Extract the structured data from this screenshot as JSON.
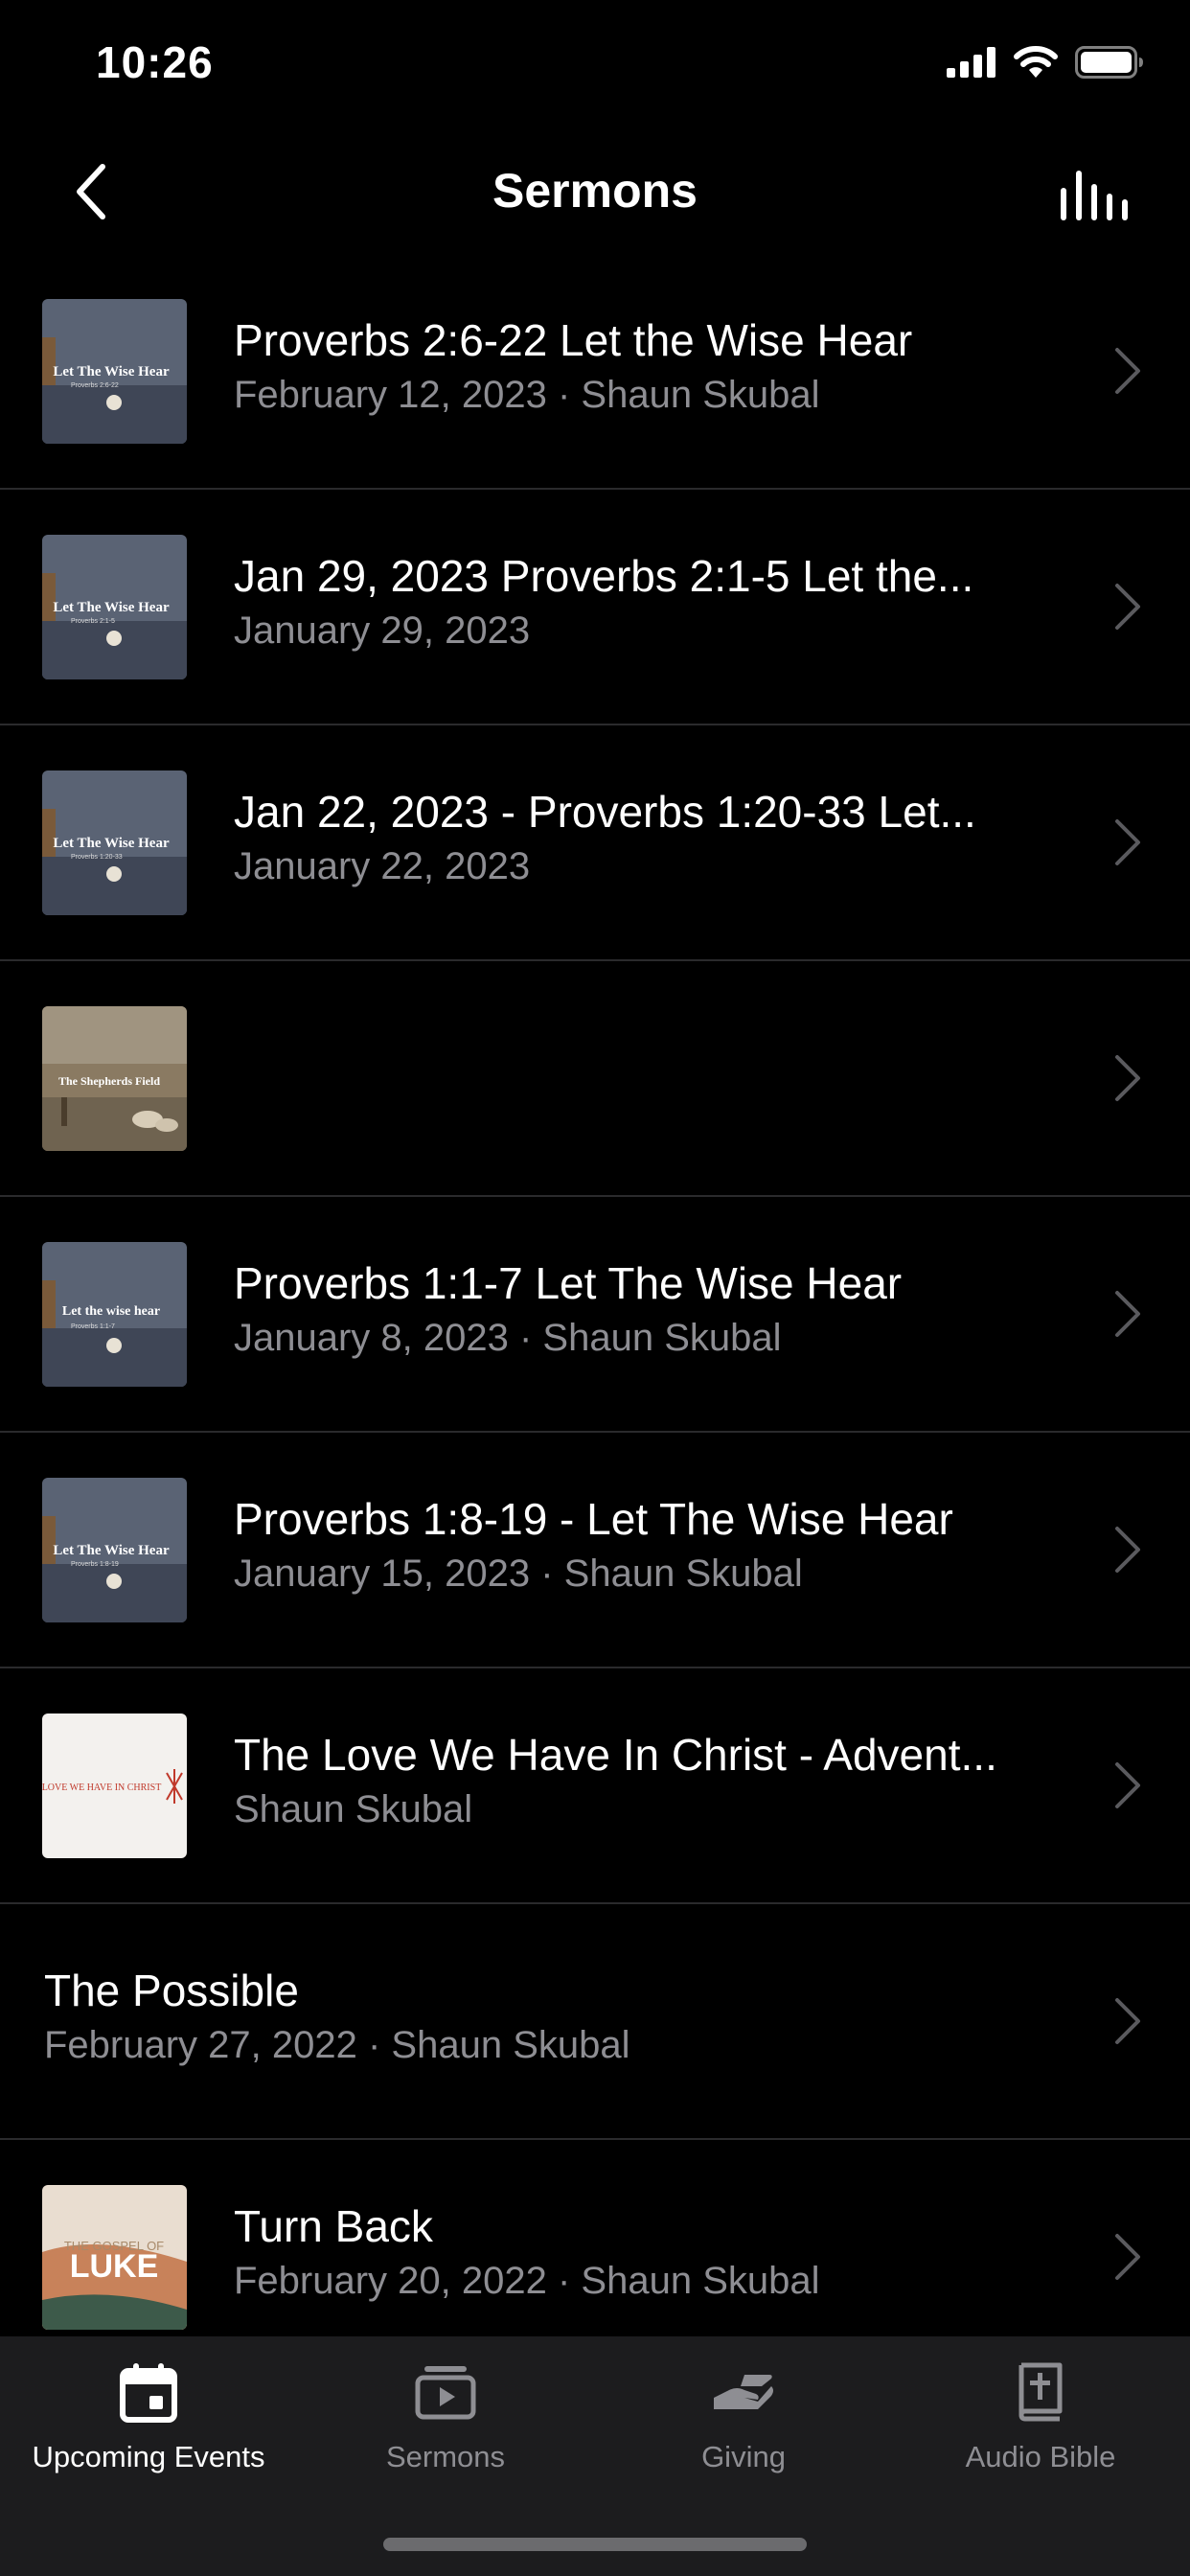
{
  "status_bar": {
    "time": "10:26"
  },
  "nav": {
    "title": "Sermons"
  },
  "sermons": [
    {
      "title": "Proverbs 2:6-22 Let the Wise Hear",
      "subtitle": "February 12, 2023 · Shaun Skubal",
      "thumb_caption": "Let The Wise Hear",
      "thumb_small": "Proverbs 2:6-22"
    },
    {
      "title": "Jan 29, 2023  Proverbs 2:1-5 Let the...",
      "subtitle": "January 29, 2023",
      "thumb_caption": "Let The Wise Hear",
      "thumb_small": "Proverbs 2:1-5"
    },
    {
      "title": "Jan 22, 2023  - Proverbs 1:20-33 Let...",
      "subtitle": "January 22, 2023",
      "thumb_caption": "Let The Wise Hear",
      "thumb_small": "Proverbs 1:20-33"
    },
    {
      "title": "",
      "subtitle": "",
      "thumb_caption": "The Shepherds Field"
    },
    {
      "title": "Proverbs 1:1-7 Let The Wise Hear",
      "subtitle": "January 8, 2023 · Shaun Skubal",
      "thumb_caption": "Let the wise hear",
      "thumb_small": "Proverbs 1:1-7"
    },
    {
      "title": "Proverbs 1:8-19 - Let The Wise Hear",
      "subtitle": "January 15, 2023 · Shaun Skubal",
      "thumb_caption": "Let The Wise Hear",
      "thumb_small": "Proverbs 1:8-19"
    },
    {
      "title": "The Love We Have In Christ - Advent...",
      "subtitle": "Shaun Skubal",
      "thumb_caption": "LOVE WE HAVE IN CHRIST"
    },
    {
      "title": "The Possible",
      "subtitle": "February 27, 2022 · Shaun Skubal"
    },
    {
      "title": "Turn Back",
      "subtitle": "February 20, 2022 · Shaun Skubal",
      "thumb_caption": "THE GOSPEL OF",
      "thumb_big": "LUKE"
    }
  ],
  "tabs": [
    {
      "label": "Upcoming Events",
      "icon": "calendar-icon",
      "active": true
    },
    {
      "label": "Sermons",
      "icon": "play-icon",
      "active": false
    },
    {
      "label": "Giving",
      "icon": "giving-hand-icon",
      "active": false
    },
    {
      "label": "Audio Bible",
      "icon": "bible-icon",
      "active": false
    }
  ],
  "colors": {
    "background": "#000000",
    "secondary_text": "#8e8e93",
    "tab_bar": "#1c1c1e",
    "separator": "#2a2a2c"
  }
}
